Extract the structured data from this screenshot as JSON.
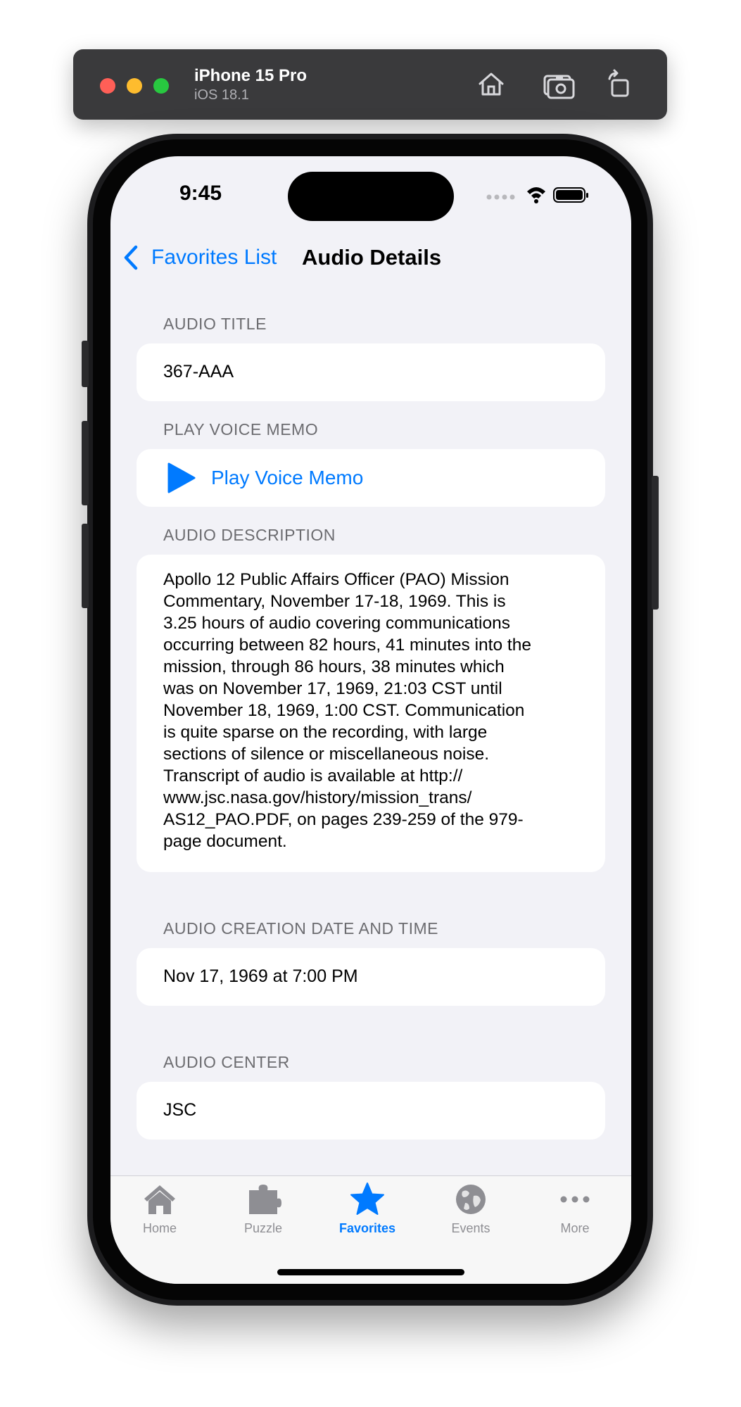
{
  "simulator": {
    "device_name": "iPhone 15 Pro",
    "os_version": "iOS 18.1"
  },
  "status_bar": {
    "time": "9:45"
  },
  "nav": {
    "back_label": "Favorites List",
    "title": "Audio Details"
  },
  "sections": {
    "title": {
      "header": "AUDIO TITLE",
      "value": "367-AAA"
    },
    "voice_memo": {
      "header": "PLAY VOICE MEMO",
      "button_label": "Play Voice Memo"
    },
    "description": {
      "header": "AUDIO DESCRIPTION",
      "lines": [
        "Apollo 12 Public Affairs Officer (PAO) Mission",
        "Commentary, November 17-18, 1969. This is",
        "3.25 hours of audio covering communications",
        "occurring between 82 hours, 41 minutes into the",
        "mission, through 86 hours, 38 minutes which",
        "was on November 17, 1969, 21:03 CST until",
        "November 18, 1969, 1:00 CST. Communication",
        "is quite sparse on the recording, with large",
        "sections of silence or miscellaneous noise.",
        "Transcript of audio is available at http://",
        "www.jsc.nasa.gov/history/mission_trans/",
        "AS12_PAO.PDF, on pages 239-259 of the 979-",
        "page document."
      ]
    },
    "creation_date": {
      "header": "AUDIO CREATION DATE AND TIME",
      "value": "Nov 17, 1969 at 7:00 PM"
    },
    "center": {
      "header": "AUDIO CENTER",
      "value": "JSC"
    }
  },
  "tabbar": {
    "tabs": [
      {
        "label": "Home",
        "icon": "house-icon",
        "active": false
      },
      {
        "label": "Puzzle",
        "icon": "puzzle-icon",
        "active": false
      },
      {
        "label": "Favorites",
        "icon": "star-icon",
        "active": true
      },
      {
        "label": "Events",
        "icon": "globe-icon",
        "active": false
      },
      {
        "label": "More",
        "icon": "ellipsis-icon",
        "active": false
      }
    ]
  },
  "colors": {
    "accent": "#007aff",
    "background": "#f2f2f7",
    "inactive_tab": "#8e8e93"
  }
}
